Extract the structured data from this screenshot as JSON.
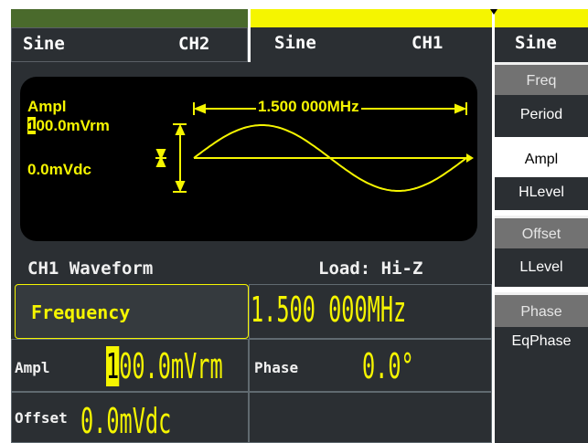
{
  "header": {
    "ch2_waveform": "Sine",
    "ch2_label": "CH2",
    "ch1_waveform": "Sine",
    "ch1_label": "CH1",
    "menu_title": "Sine"
  },
  "display": {
    "param_name": "Ampl",
    "amplitude_cursor_digit": "1",
    "amplitude_rest": "00.0mVrm",
    "offset": "0.0mVdc",
    "frequency": "1.500 000MHz"
  },
  "status": {
    "title": "CH1 Waveform",
    "load": "Load: Hi-Z"
  },
  "params": {
    "frequency_label": "Frequency",
    "frequency_value": "1.500 000MHz",
    "ampl_label": "Ampl",
    "ampl_cursor_digit": "1",
    "ampl_rest": "00.0mVrm",
    "phase_label": "Phase",
    "phase_value": "0.0°",
    "offset_label": "Offset",
    "offset_value": "0.0mVdc"
  },
  "softkeys": [
    {
      "label": "Freq",
      "style": "grey"
    },
    {
      "label": "Period",
      "style": "dark"
    },
    {
      "label": "Ampl",
      "style": "selected"
    },
    {
      "label": "HLevel",
      "style": "dark"
    },
    {
      "label": "Offset",
      "style": "grey"
    },
    {
      "label": "LLevel",
      "style": "dark"
    },
    {
      "label": "Phase",
      "style": "grey"
    },
    {
      "label": "EqPhase",
      "style": "dark"
    }
  ],
  "colors": {
    "accent_yellow": "#f5f500",
    "panel_dark": "#2b2f33",
    "softkey_grey": "#727272",
    "ch2_green": "#4a6a2c"
  }
}
